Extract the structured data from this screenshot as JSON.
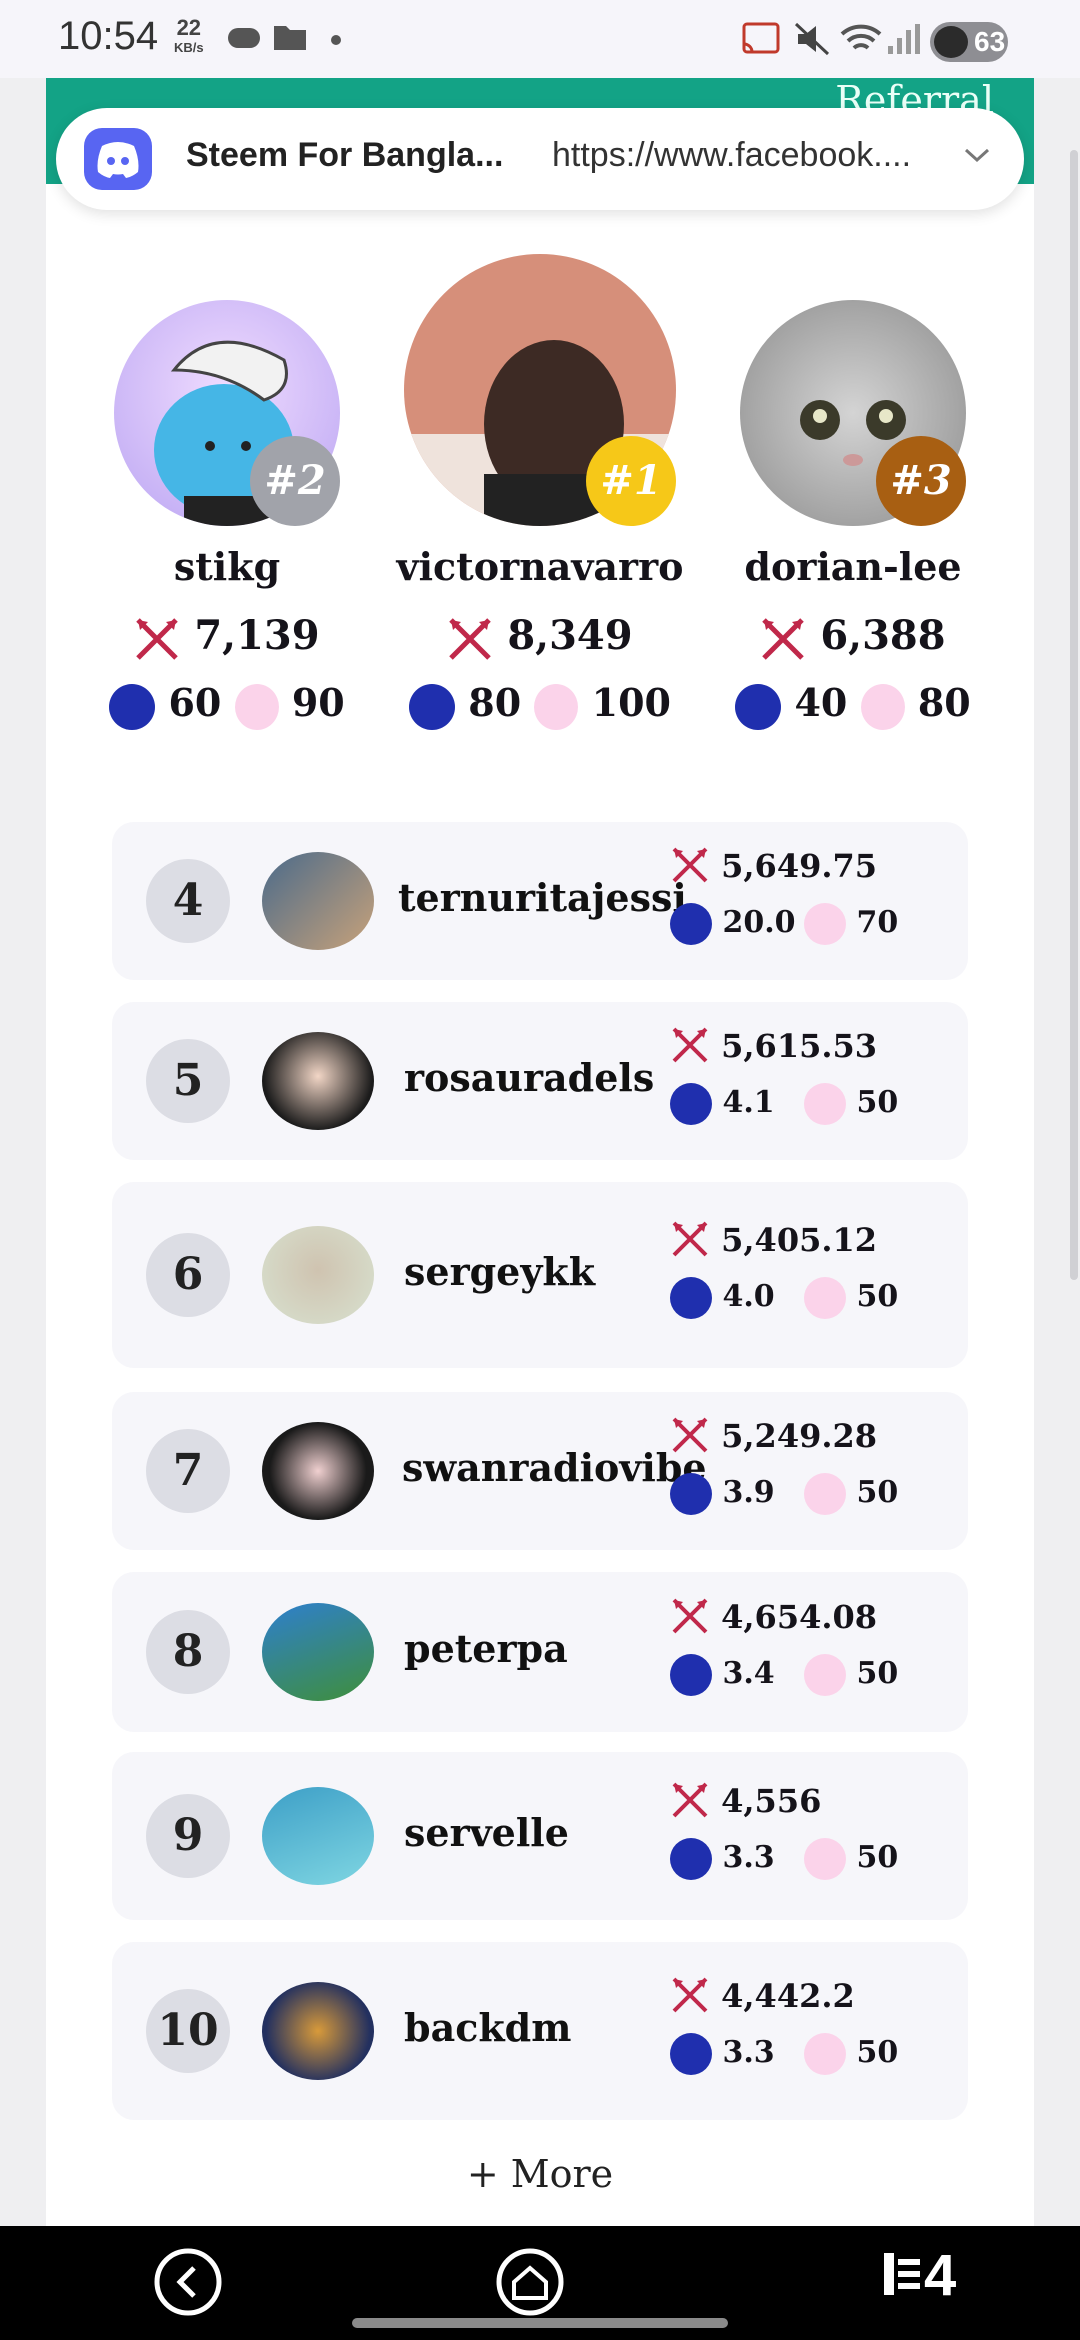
{
  "status_bar": {
    "time": "10:54",
    "speed_value": "22",
    "speed_unit": "KB/s",
    "battery": "63"
  },
  "header": {
    "referral_label": "Referral"
  },
  "notification": {
    "app_icon": "discord-icon",
    "title": "Steem For Bangla...",
    "url": "https://www.facebook...."
  },
  "podium": [
    {
      "rank_badge": "#2",
      "name": "stikg",
      "score": "7,139",
      "sp": "60",
      "cards": "90",
      "badge_color": "#a1a3aa"
    },
    {
      "rank_badge": "#1",
      "name": "victornavarro",
      "score": "8,349",
      "sp": "80",
      "cards": "100",
      "badge_color": "#f6c818"
    },
    {
      "rank_badge": "#3",
      "name": "dorian-lee",
      "score": "6,388",
      "sp": "40",
      "cards": "80",
      "badge_color": "#a85f12"
    }
  ],
  "leaderboard": [
    {
      "rank": "4",
      "name": "ternuritajessi",
      "score": "5,649.75",
      "sp": "20.0",
      "cards": "70"
    },
    {
      "rank": "5",
      "name": "rosauradels",
      "score": "5,615.53",
      "sp": "4.1",
      "cards": "50"
    },
    {
      "rank": "6",
      "name": "sergeykk",
      "score": "5,405.12",
      "sp": "4.0",
      "cards": "50"
    },
    {
      "rank": "7",
      "name": "swanradiovibe",
      "score": "5,249.28",
      "sp": "3.9",
      "cards": "50"
    },
    {
      "rank": "8",
      "name": "peterpa",
      "score": "4,654.08",
      "sp": "3.4",
      "cards": "50"
    },
    {
      "rank": "9",
      "name": "servelle",
      "score": "4,556",
      "sp": "3.3",
      "cards": "50"
    },
    {
      "rank": "10",
      "name": "backdm",
      "score": "4,442.2",
      "sp": "3.3",
      "cards": "50"
    }
  ],
  "more_label": "+ More",
  "nav": {
    "tabs_count": "4"
  },
  "colors": {
    "teal": "#13a386",
    "steem_blue": "#1f2fae",
    "sword_red": "#c0284a"
  }
}
